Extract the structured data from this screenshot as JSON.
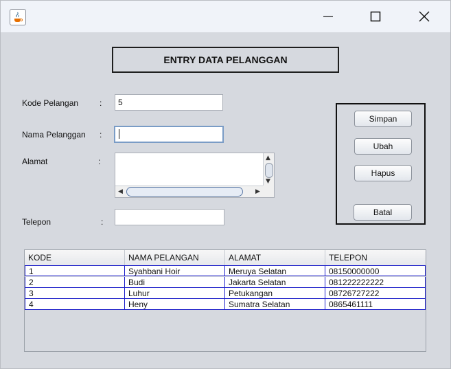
{
  "window": {
    "app_icon": "java-icon",
    "controls": {
      "minimize": "minimize-icon",
      "maximize": "maximize-icon",
      "close": "close-icon"
    }
  },
  "header": {
    "title": "ENTRY DATA PELANGGAN"
  },
  "form": {
    "kode": {
      "label": "Kode Pelangan",
      "colon": ":",
      "value": "5"
    },
    "nama": {
      "label": "Nama Pelanggan",
      "colon": ":",
      "value": ""
    },
    "alamat": {
      "label": "Alamat",
      "colon": ":",
      "value": ""
    },
    "telepon": {
      "label": "Telepon",
      "colon": ":",
      "value": ""
    }
  },
  "buttons": {
    "simpan": "Simpan",
    "ubah": "Ubah",
    "hapus": "Hapus",
    "batal": "Batal"
  },
  "table": {
    "columns": [
      "KODE",
      "NAMA PELANGAN",
      "ALAMAT",
      "TELEPON"
    ],
    "rows": [
      [
        "1",
        "Syahbani Hoir",
        "Meruya Selatan",
        "08150000000"
      ],
      [
        "2",
        "Budi",
        "Jakarta Selatan",
        "081222222222"
      ],
      [
        "3",
        "Luhur",
        "Petukangan",
        "08726727222"
      ],
      [
        "4",
        "Heny",
        "Sumatra Selatan",
        "0865461111"
      ]
    ]
  }
}
